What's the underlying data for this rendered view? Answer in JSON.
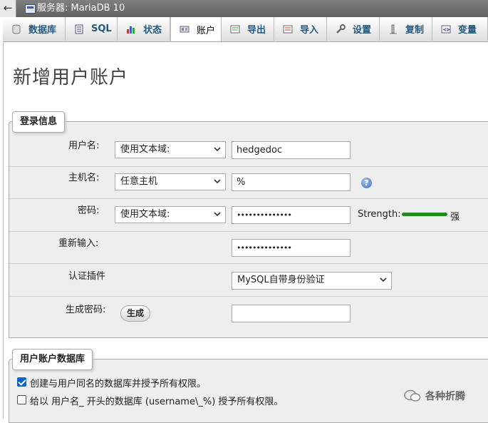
{
  "server_bar": {
    "back_glyph": "←",
    "title": "服务器: MariaDB 10"
  },
  "tabs": [
    {
      "label": "数据库",
      "icon": "database-icon"
    },
    {
      "label": "SQL",
      "icon": "sql-icon"
    },
    {
      "label": "状态",
      "icon": "status-icon"
    },
    {
      "label": "账户",
      "icon": "accounts-icon",
      "active": true
    },
    {
      "label": "导出",
      "icon": "export-icon"
    },
    {
      "label": "导入",
      "icon": "import-icon"
    },
    {
      "label": "设置",
      "icon": "settings-icon"
    },
    {
      "label": "复制",
      "icon": "replication-icon"
    },
    {
      "label": "变量",
      "icon": "variables-icon"
    }
  ],
  "page_title": "新增用户账户",
  "login_info": {
    "legend": "登录信息",
    "username": {
      "label": "用户名:",
      "select": "使用文本域:",
      "value": "hedgedoc"
    },
    "hostname": {
      "label": "主机名:",
      "select": "任意主机",
      "value": "%"
    },
    "password": {
      "label": "密码:",
      "select": "使用文本域:",
      "value": "••••••••••••••",
      "strength_label": "Strength:",
      "strength_value": "强",
      "strength_color": "#1e8a1e"
    },
    "retype": {
      "label": "重新输入:",
      "value": "••••••••••••••"
    },
    "auth_plugin": {
      "label": "认证插件",
      "select": "MySQL自带身份验证"
    },
    "generate": {
      "label": "生成密码:",
      "button": "生成",
      "value": ""
    }
  },
  "user_db": {
    "legend": "用户账户数据库",
    "options": [
      {
        "label": "创建与用户同名的数据库并授予所有权限。",
        "checked": true
      },
      {
        "label": "给以 用户名_ 开头的数据库 (username\\_%) 授予所有权限。",
        "checked": false
      }
    ]
  },
  "watermark": "各种折腾",
  "colors": {
    "accent_checkbox": "#0b62c9",
    "tab_text": "#235a81"
  }
}
